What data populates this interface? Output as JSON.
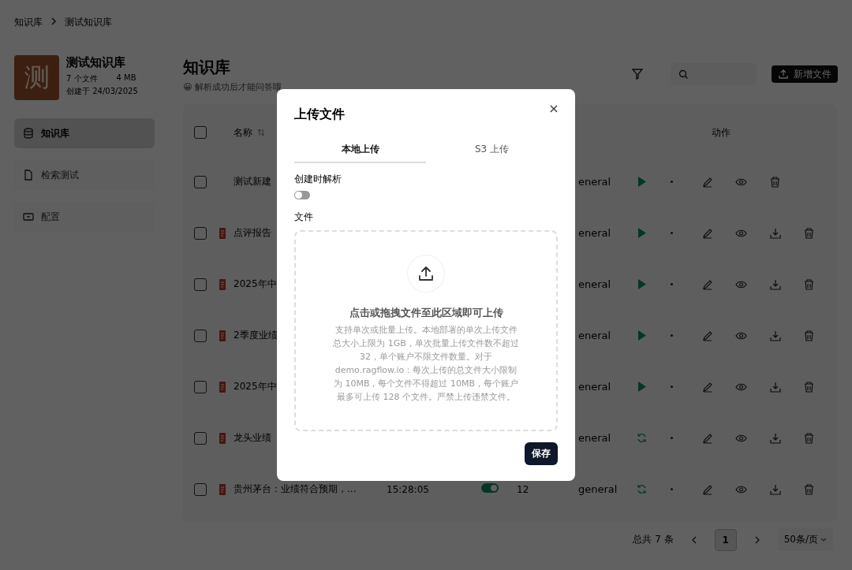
{
  "breadcrumb": [
    "知识库",
    "测试知识库"
  ],
  "kb": {
    "avatar": "测",
    "name": "测试知识库",
    "files": "7 个文件",
    "size": "4 MB",
    "created": "创建于 24/03/2025"
  },
  "sidebar": {
    "items": [
      {
        "label": "知识库",
        "selected": true
      },
      {
        "label": "检索测试",
        "selected": false
      },
      {
        "label": "配置",
        "selected": false
      }
    ]
  },
  "header": {
    "title": "知识库",
    "hint": "解析成功后才能问答哦",
    "hint_emoji": "😀",
    "add_button": "新增文件"
  },
  "table": {
    "all_checked": false,
    "columns": {
      "name": "名称",
      "actions": "动作"
    },
    "rows": [
      {
        "checked": false,
        "name": "测试新建",
        "file_icon": false,
        "method": "eneral",
        "kind": "run",
        "download": false
      },
      {
        "checked": false,
        "name": "点评报告",
        "file_icon": true,
        "method": "eneral",
        "kind": "run",
        "download": true
      },
      {
        "checked": false,
        "name": "2025年中",
        "file_icon": true,
        "method": "eneral",
        "kind": "run",
        "download": true
      },
      {
        "checked": false,
        "name": "2季度业绩",
        "file_icon": true,
        "method": "eneral",
        "kind": "run",
        "download": true
      },
      {
        "checked": false,
        "name": "2025年中",
        "file_icon": true,
        "method": "eneral",
        "kind": "run",
        "download": true
      },
      {
        "checked": false,
        "name": "龙头业绩",
        "file_icon": true,
        "method": "eneral",
        "kind": "refresh",
        "download": true
      },
      {
        "checked": false,
        "name": "贵州茅台：业绩符合预期，...",
        "file_icon": true,
        "date": "15:28:05",
        "enabled": true,
        "chunks": "12",
        "method": "general",
        "kind": "refresh",
        "download": true
      }
    ]
  },
  "pagination": {
    "total": "总共 7 条",
    "pages": [
      {
        "label": "1",
        "selected": true
      }
    ],
    "page_size": "50条/页"
  },
  "dialog": {
    "title": "上传文件",
    "tabs": [
      {
        "label": "本地上传",
        "selected": true
      },
      {
        "label": "S3 上传",
        "selected": false
      }
    ],
    "parse_label": "创建时解析",
    "parse_on": false,
    "file_label": "文件",
    "drop_title": "点击或拖拽文件至此区域即可上传",
    "drop_text": "支持单次或批量上传。本地部署的单次上传文件总大小上限为 1GB，单次批量上传文件数不超过 32，单个账户不限文件数量。对于 demo.ragflow.io：每次上传的总文件大小限制为 10MB，每个文件不得超过 10MB，每个账户最多可上传 128 个文件。严禁上传违禁文件。",
    "save": "保存"
  }
}
